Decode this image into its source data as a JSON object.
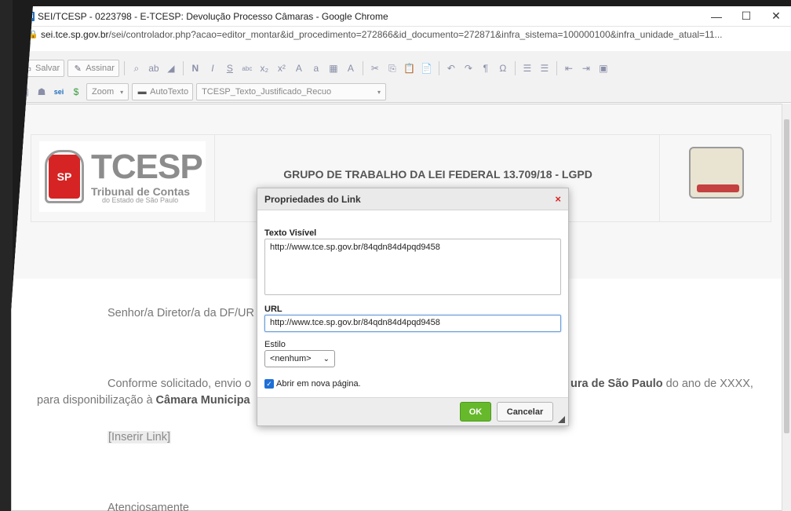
{
  "window": {
    "favicon": "sei",
    "title": "SEI/TCESP - 0223798 - E-TCESP: Devolução Processo Câmaras - Google Chrome",
    "minimize": "—",
    "maximize": "☐",
    "close": "✕"
  },
  "address": {
    "host": "sei.tce.sp.gov.br",
    "path": "/sei/controlador.php?acao=editor_montar&id_procedimento=272866&id_documento=272871&infra_sistema=100000100&infra_unidade_atual=11..."
  },
  "toolbar": {
    "save_label": "Salvar",
    "sign_label": "Assinar",
    "zoom_label": "Zoom",
    "autotext_label": "AutoTexto",
    "style_select": "TCESP_Texto_Justificado_Recuo",
    "icons_row1": [
      "find-icon",
      "replace-icon",
      "eraser-icon",
      "bold-icon",
      "italic-icon",
      "underline-icon",
      "strike-icon",
      "subscript-icon",
      "superscript-icon",
      "uppercase-icon",
      "lowercase-icon",
      "table-insert-icon",
      "font-color-icon",
      "cut-icon",
      "copy-icon",
      "paste-icon",
      "paste-text-icon",
      "undo-icon",
      "redo-icon",
      "paragraph-icon",
      "omega-icon",
      "ordered-list-icon",
      "unordered-list-icon",
      "outdent-icon",
      "indent-icon",
      "image-icon"
    ],
    "glyphs_row1": [
      "⌕",
      "ab",
      "◢",
      "N",
      "I",
      "S",
      "abc",
      "x₂",
      "x²",
      "A",
      "a",
      "▦",
      "A",
      "✂",
      "⎘",
      "📋",
      "📄",
      "↶",
      "↷",
      "¶",
      "Ω",
      "☰",
      "☰",
      "⇤",
      "⇥",
      "▣"
    ]
  },
  "document": {
    "header_title": "GRUPO DE TRABALHO DA LEI FEDERAL 13.709/18 - LGPD",
    "logo": {
      "initials": "SP",
      "brand": "TCESP",
      "line1": "Tribunal de Contas",
      "line2": "do Estado de São Paulo"
    },
    "greeting": "Senhor/a Diretor/a da DF/UR",
    "para_start": "Conforme solicitado, envio o",
    "para_bold_right": "ura de São Paulo",
    "para_end": " do ano de XXXX,",
    "para2_start": "para disponibilização à ",
    "para2_bold": "Câmara Municipa",
    "insert_link": "[Inserir Link]",
    "closing": "Atenciosamente"
  },
  "dialog": {
    "title": "Propriedades do Link",
    "close": "×",
    "visible_text_label": "Texto Visível",
    "visible_text_value": "http://www.tce.sp.gov.br/84qdn84d4pqd9458",
    "url_label": "URL",
    "url_value": "http://www.tce.sp.gov.br/84qdn84d4pqd9458",
    "style_label": "Estilo",
    "style_value": "<nenhum>",
    "open_new_label": "Abrir em nova página.",
    "open_new_checked": true,
    "ok_label": "OK",
    "cancel_label": "Cancelar"
  },
  "colors": {
    "ok_green": "#67b92c",
    "close_red": "#dd2222",
    "checkbox_blue": "#1f6fd6"
  }
}
